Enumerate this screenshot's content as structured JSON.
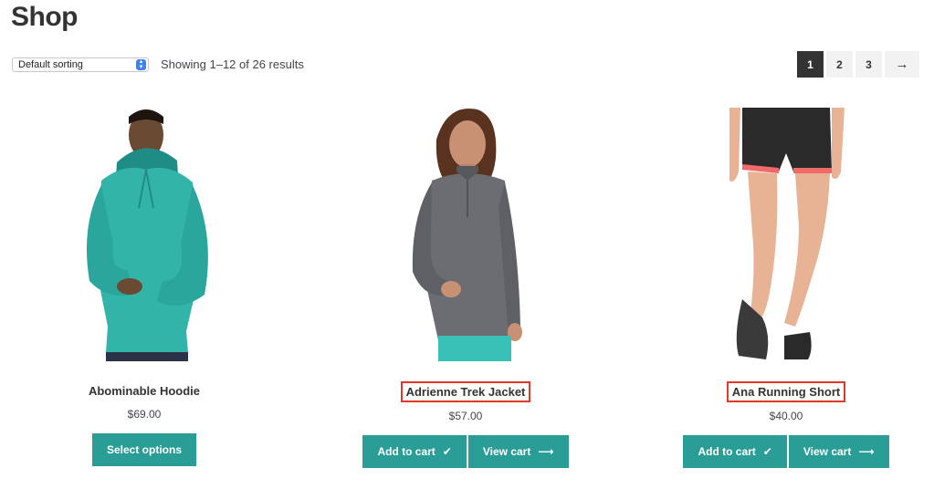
{
  "page": {
    "title": "Shop"
  },
  "toolbar": {
    "sorting_value": "Default sorting",
    "result_count": "Showing 1–12 of 26 results"
  },
  "pagination": {
    "pages": [
      "1",
      "2",
      "3"
    ],
    "current": "1",
    "next_label": "→"
  },
  "products": [
    {
      "name": "Abominable Hoodie",
      "price": "$69.00",
      "button": "Select options",
      "colors": {
        "garment": "#32b4a9",
        "garment_dark": "#1f8d86",
        "skin": "#6b4a34"
      }
    },
    {
      "name": "Adrienne Trek Jacket",
      "price": "$57.00",
      "add_to_cart": "Add to cart",
      "view_cart": "View cart",
      "colors": {
        "garment": "#6c6d72",
        "garment_dark": "#57585c",
        "skin": "#c99174",
        "hair": "#5a3220",
        "pants": "#38c2b6"
      }
    },
    {
      "name": "Ana Running Short",
      "price": "$40.00",
      "add_to_cart": "Add to cart",
      "view_cart": "View cart",
      "colors": {
        "garment": "#2a2a2a",
        "accent": "#f06a6a",
        "skin": "#e8b295",
        "shoe": "#3a3a3a"
      }
    }
  ],
  "theme": {
    "accent": "#2a9d96",
    "highlight_border": "#e0382b"
  }
}
